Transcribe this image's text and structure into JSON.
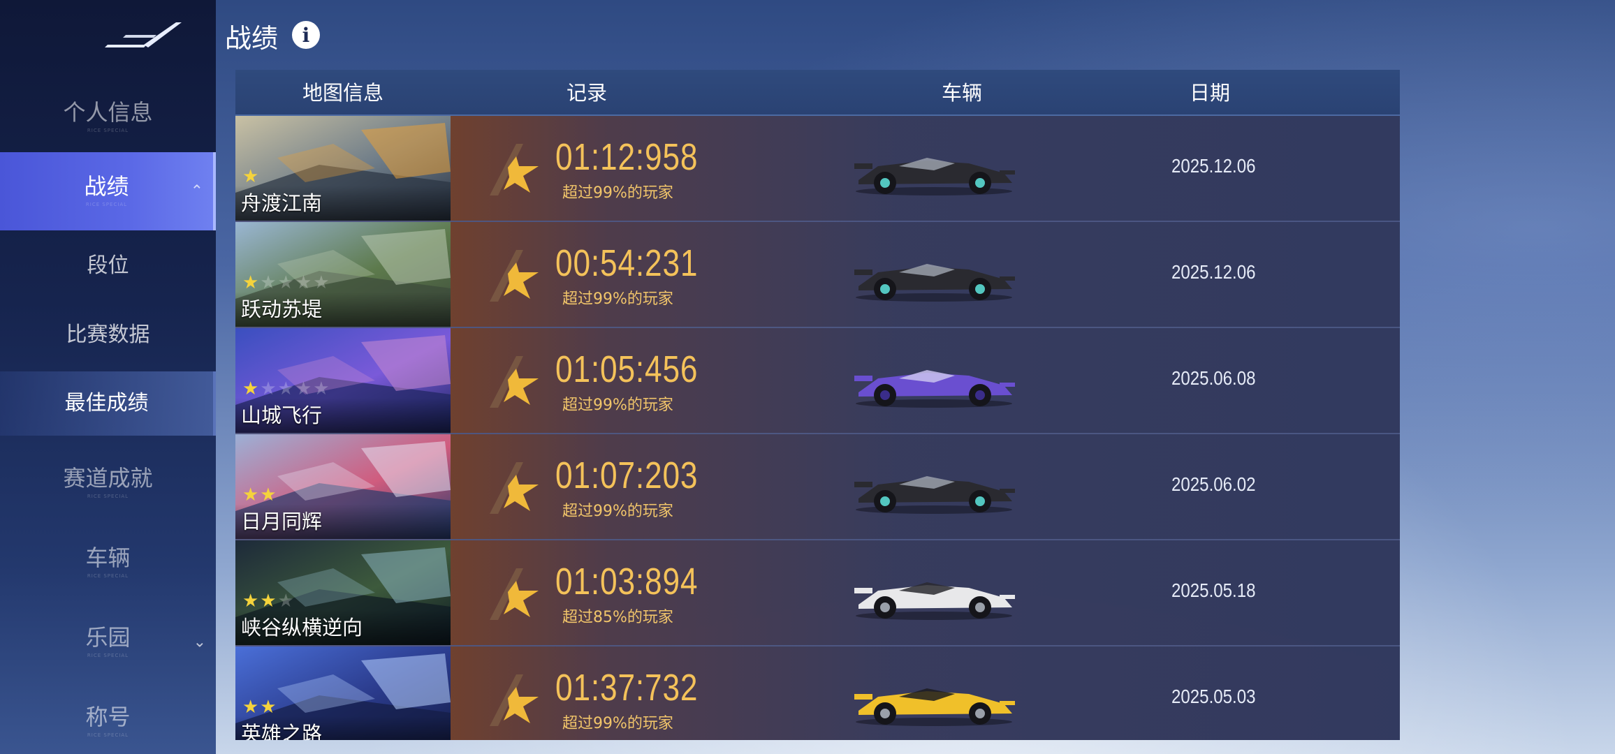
{
  "sidebar": {
    "items": [
      {
        "label": "个人信息",
        "sub": "RICE SPECIAL"
      },
      {
        "label": "战绩",
        "sub": "RICE SPECIAL"
      },
      {
        "label": "段位"
      },
      {
        "label": "比赛数据"
      },
      {
        "label": "最佳成绩"
      },
      {
        "label": "赛道成就",
        "sub": "RICE SPECIAL"
      },
      {
        "label": "车辆",
        "sub": "RICE SPECIAL"
      },
      {
        "label": "乐园",
        "sub": "RICE SPECIAL"
      },
      {
        "label": "称号",
        "sub": "RICE SPECIAL"
      }
    ]
  },
  "header": {
    "title": "战绩",
    "info_icon": "i"
  },
  "table": {
    "columns": [
      "地图信息",
      "记录",
      "车辆",
      "日期"
    ],
    "rows": [
      {
        "map": "舟渡江南",
        "stars": "★",
        "stars_dim": "",
        "time": "01:12:958",
        "pct": "超过99%的玩家",
        "car": "black-formula-car",
        "date": "2025.12.06"
      },
      {
        "map": "跃动苏堤",
        "stars": "★",
        "stars_dim": "★★★★",
        "time": "00:54:231",
        "pct": "超过99%的玩家",
        "car": "black-formula-car",
        "date": "2025.12.06"
      },
      {
        "map": "山城飞行",
        "stars": "★",
        "stars_dim": "★★★★",
        "time": "01:05:456",
        "pct": "超过99%的玩家",
        "car": "purple-hypercar",
        "date": "2025.06.08"
      },
      {
        "map": "日月同辉",
        "stars": "★★",
        "stars_dim": "",
        "time": "01:07:203",
        "pct": "超过99%的玩家",
        "car": "black-formula-car",
        "date": "2025.06.02"
      },
      {
        "map": "峡谷纵横逆向",
        "stars": "★★",
        "stars_dim": "★",
        "time": "01:03:894",
        "pct": "超过85%的玩家",
        "car": "white-supercar",
        "date": "2025.05.18"
      },
      {
        "map": "英雄之路",
        "stars": "★★",
        "stars_dim": "",
        "time": "01:37:732",
        "pct": "超过99%的玩家",
        "car": "yellow-buggy",
        "date": "2025.05.03"
      }
    ]
  },
  "colors": {
    "accent": "#5a68e6",
    "time": "#f4c25a",
    "star": "#f5d33c"
  }
}
